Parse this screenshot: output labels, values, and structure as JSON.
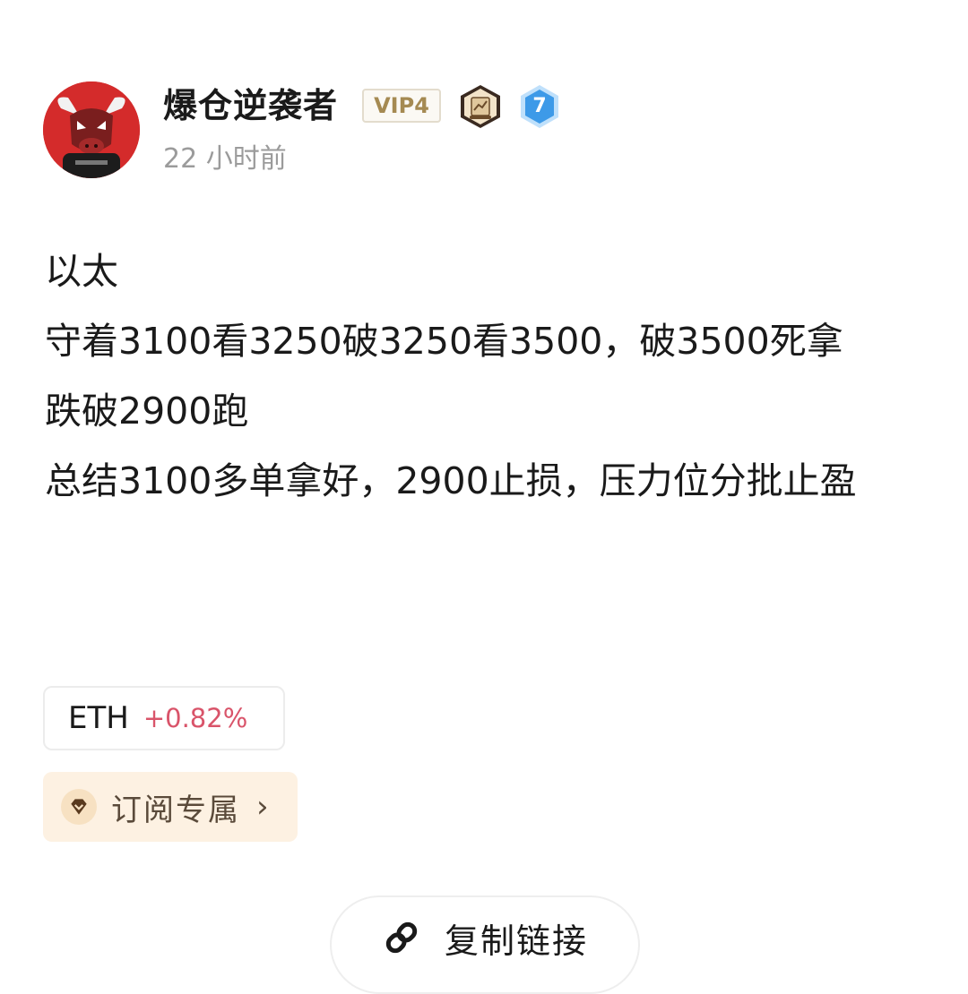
{
  "author": {
    "name": "爆仓逆袭者",
    "vip_label": "VIP4",
    "level": "7",
    "time": "22 小时前",
    "avatar_icon": "bull-avatar",
    "badge_icon": "scroll-badge-icon"
  },
  "post": {
    "lines": [
      "以太",
      "守着3100看3250破3250看3500，破3500死拿",
      "跌破2900跑",
      "总结3100多单拿好，2900止损，压力位分批止盈"
    ]
  },
  "ticker": {
    "symbol": "ETH",
    "change": "+0.82%",
    "change_color": "#d9546a"
  },
  "subscribe": {
    "label": "订阅专属",
    "arrow": "›",
    "icon": "diamond-icon"
  },
  "copy_link": {
    "label": "复制链接",
    "icon": "link-icon"
  },
  "colors": {
    "avatar_bg": "#d42b2b",
    "vip_text": "#a58a52",
    "level_badge": "#3d9ae8",
    "subscribe_bg": "#fdf1e2"
  }
}
